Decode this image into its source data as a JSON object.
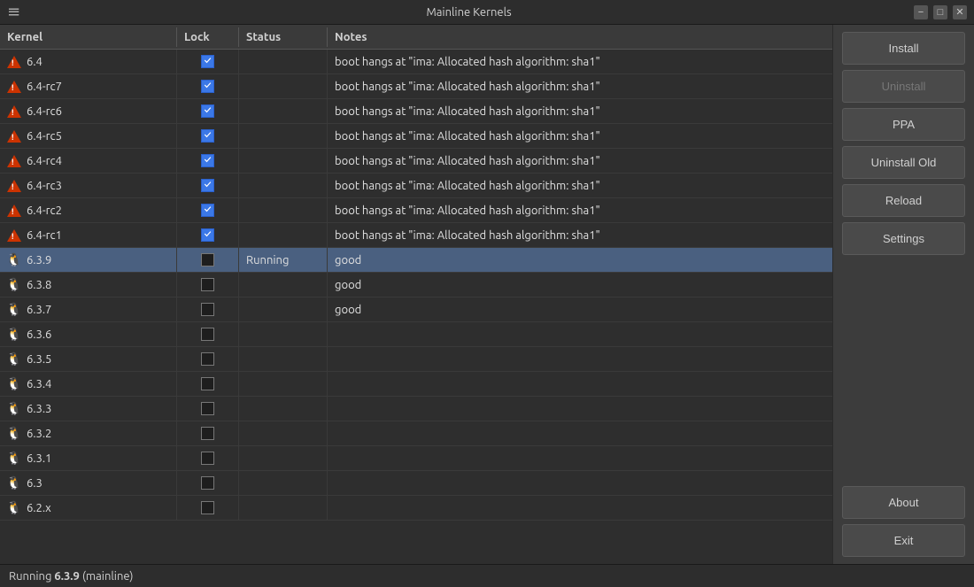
{
  "titlebar": {
    "title": "Mainline Kernels",
    "minimize_label": "−",
    "maximize_label": "□",
    "close_label": "✕",
    "menu_label": "≡"
  },
  "table": {
    "headers": [
      "Kernel",
      "Lock",
      "Status",
      "Notes"
    ],
    "rows": [
      {
        "icon": "warning",
        "kernel": "6.4",
        "locked": true,
        "status": "",
        "notes": "boot hangs at \"ima: Allocated hash algorithm: sha1\""
      },
      {
        "icon": "warning",
        "kernel": "6.4-rc7",
        "locked": true,
        "status": "",
        "notes": "boot hangs at \"ima: Allocated hash algorithm: sha1\""
      },
      {
        "icon": "warning",
        "kernel": "6.4-rc6",
        "locked": true,
        "status": "",
        "notes": "boot hangs at \"ima: Allocated hash algorithm: sha1\""
      },
      {
        "icon": "warning",
        "kernel": "6.4-rc5",
        "locked": true,
        "status": "",
        "notes": "boot hangs at \"ima: Allocated hash algorithm: sha1\""
      },
      {
        "icon": "warning",
        "kernel": "6.4-rc4",
        "locked": true,
        "status": "",
        "notes": "boot hangs at \"ima: Allocated hash algorithm: sha1\""
      },
      {
        "icon": "warning",
        "kernel": "6.4-rc3",
        "locked": true,
        "status": "",
        "notes": "boot hangs at \"ima: Allocated hash algorithm: sha1\""
      },
      {
        "icon": "warning",
        "kernel": "6.4-rc2",
        "locked": true,
        "status": "",
        "notes": "boot hangs at \"ima: Allocated hash algorithm: sha1\""
      },
      {
        "icon": "warning",
        "kernel": "6.4-rc1",
        "locked": true,
        "status": "",
        "notes": "boot hangs at \"ima: Allocated hash algorithm: sha1\""
      },
      {
        "icon": "tux",
        "kernel": "6.3.9",
        "locked": false,
        "status": "Running",
        "notes": "good"
      },
      {
        "icon": "tux",
        "kernel": "6.3.8",
        "locked": false,
        "status": "",
        "notes": "good"
      },
      {
        "icon": "tux",
        "kernel": "6.3.7",
        "locked": false,
        "status": "",
        "notes": "good"
      },
      {
        "icon": "tux",
        "kernel": "6.3.6",
        "locked": false,
        "status": "",
        "notes": ""
      },
      {
        "icon": "tux",
        "kernel": "6.3.5",
        "locked": false,
        "status": "",
        "notes": ""
      },
      {
        "icon": "tux",
        "kernel": "6.3.4",
        "locked": false,
        "status": "",
        "notes": ""
      },
      {
        "icon": "tux",
        "kernel": "6.3.3",
        "locked": false,
        "status": "",
        "notes": ""
      },
      {
        "icon": "tux",
        "kernel": "6.3.2",
        "locked": false,
        "status": "",
        "notes": ""
      },
      {
        "icon": "tux",
        "kernel": "6.3.1",
        "locked": false,
        "status": "",
        "notes": ""
      },
      {
        "icon": "tux",
        "kernel": "6.3",
        "locked": false,
        "status": "",
        "notes": ""
      },
      {
        "icon": "tux",
        "kernel": "6.2.x",
        "locked": false,
        "status": "",
        "notes": ""
      }
    ]
  },
  "sidebar": {
    "buttons": [
      {
        "id": "install",
        "label": "Install",
        "disabled": false
      },
      {
        "id": "uninstall",
        "label": "Uninstall",
        "disabled": true
      },
      {
        "id": "ppa",
        "label": "PPA",
        "disabled": false
      },
      {
        "id": "uninstall-old",
        "label": "Uninstall Old",
        "disabled": false
      },
      {
        "id": "reload",
        "label": "Reload",
        "disabled": false
      },
      {
        "id": "settings",
        "label": "Settings",
        "disabled": false
      },
      {
        "id": "about",
        "label": "About",
        "disabled": false
      },
      {
        "id": "exit",
        "label": "Exit",
        "disabled": false
      }
    ]
  },
  "statusbar": {
    "prefix": "Running",
    "kernel": "6.3.9",
    "suffix": "(mainline)"
  }
}
